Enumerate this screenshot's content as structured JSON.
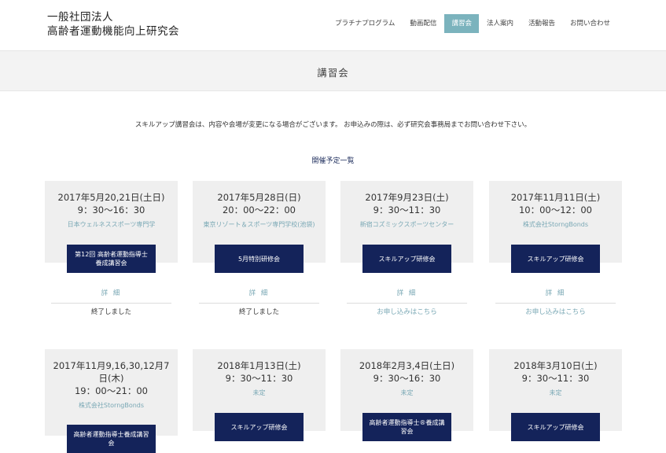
{
  "header": {
    "logo_line1": "一般社団法人",
    "logo_line2": "高齢者運動機能向上研究会",
    "nav": [
      {
        "label": "プラチナプログラム",
        "active": false
      },
      {
        "label": "動画配信",
        "active": false
      },
      {
        "label": "講習会",
        "active": true
      },
      {
        "label": "法人案内",
        "active": false
      },
      {
        "label": "活動報告",
        "active": false
      },
      {
        "label": "お問い合わせ",
        "active": false
      }
    ]
  },
  "page_title": "講習会",
  "intro": "スキルアップ講習会は、内容や会場が変更になる場合がございます。 お申込みの際は、必ず研究会事務局までお問い合わせ下さい。",
  "section_heading": "開催予定一覧",
  "cards": [
    {
      "date": "2017年5月20,21日(土日)",
      "time": "9：30〜16：30",
      "venue": "日本ウェルネススポーツ専門学",
      "title": "第12回 高齢者運動指導士養成講習会",
      "detail": "詳 細",
      "status": "終了しました",
      "status_type": "ended"
    },
    {
      "date": "2017年5月28日(日)",
      "time": "20：00〜22：00",
      "venue": "東京リゾート＆スポーツ専門学校(池袋)",
      "title": "5月特別研修会",
      "detail": "詳 細",
      "status": "終了しました",
      "status_type": "ended"
    },
    {
      "date": "2017年9月23日(土)",
      "time": "9：30〜11：30",
      "venue": "新宿コズミックスポーツセンター",
      "title": "スキルアップ研修会",
      "detail": "詳 細",
      "status": "お申し込みはこちら",
      "status_type": "link"
    },
    {
      "date": "2017年11月11日(土)",
      "time": "10：00〜12：00",
      "venue": "株式会社StorngBonds",
      "title": "スキルアップ研修会",
      "detail": "詳 細",
      "status": "お申し込みはこちら",
      "status_type": "link"
    },
    {
      "date": "2017年11月9,16,30,12月7日(木)",
      "time": "19：00〜21：00",
      "venue": "株式会社StorngBonds",
      "title": "高齢者運動指導士養成講習会",
      "detail": "",
      "status": "",
      "status_type": ""
    },
    {
      "date": "2018年1月13日(土)",
      "time": "9：30〜11：30",
      "venue": "未定",
      "title": "スキルアップ研修会",
      "detail": "",
      "status": "",
      "status_type": ""
    },
    {
      "date": "2018年2月3,4日(土日)",
      "time": "9：30〜16：30",
      "venue": "未定",
      "title": "高齢者運動指導士®養成講習会",
      "detail": "",
      "status": "",
      "status_type": ""
    },
    {
      "date": "2018年3月10日(土)",
      "time": "9：30〜11：30",
      "venue": "未定",
      "title": "スキルアップ研修会",
      "detail": "",
      "status": "",
      "status_type": ""
    }
  ]
}
